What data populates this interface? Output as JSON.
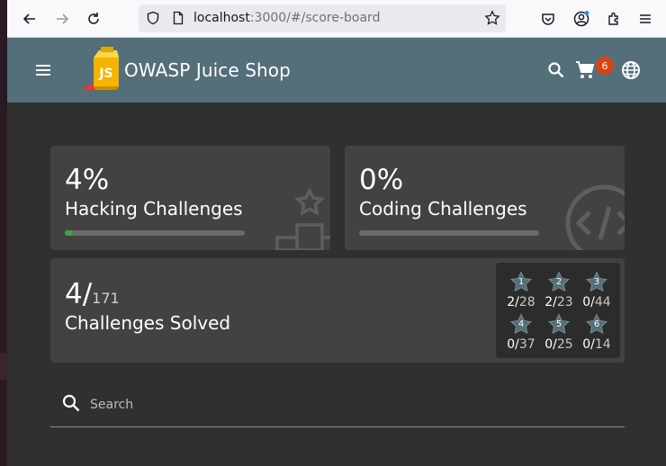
{
  "browser": {
    "url_host": "localhost",
    "url_rest": ":3000/#/score-board"
  },
  "app": {
    "title": "OWASP Juice Shop",
    "logo_text": "JS",
    "cart_count": "6"
  },
  "cards": {
    "hacking": {
      "percent": "4%",
      "label": "Hacking Challenges",
      "progress": 0.04
    },
    "coding": {
      "percent": "0%",
      "label": "Coding Challenges",
      "progress": 0.0
    },
    "solved": {
      "count": "4/",
      "total": "171",
      "label": "Challenges Solved"
    }
  },
  "difficulties": [
    {
      "level": "1",
      "solved": "2/",
      "total": "28"
    },
    {
      "level": "2",
      "solved": "2/",
      "total": "23"
    },
    {
      "level": "3",
      "solved": "0/",
      "total": "44"
    },
    {
      "level": "4",
      "solved": "0/",
      "total": "37"
    },
    {
      "level": "5",
      "solved": "0/",
      "total": "25"
    },
    {
      "level": "6",
      "solved": "0/",
      "total": "14"
    }
  ],
  "search": {
    "placeholder": "Search"
  },
  "colors": {
    "toolbar": "#546e7a",
    "background": "#303030",
    "card": "#424242",
    "progress_fill": "#43a047",
    "badge": "#d84315",
    "star": "#546e7a"
  }
}
